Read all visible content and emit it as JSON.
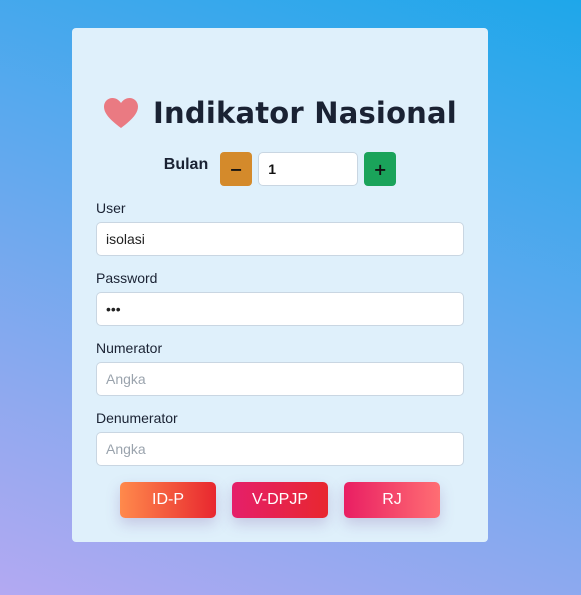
{
  "header": {
    "title": "Indikator Nasional",
    "heart_color": "#ea7a82"
  },
  "bulan": {
    "label": "Bulan",
    "minus_label": "−",
    "plus_label": "+",
    "value": "1"
  },
  "fields": {
    "user": {
      "label": "User",
      "value": "isolasi"
    },
    "password": {
      "label": "Password",
      "value": "•••"
    },
    "numerator": {
      "label": "Numerator",
      "placeholder": "Angka"
    },
    "denumerator": {
      "label": "Denumerator",
      "placeholder": "Angka"
    }
  },
  "buttons": {
    "idp": "ID-P",
    "vdpjp": "V-DPJP",
    "rj": "RJ"
  }
}
